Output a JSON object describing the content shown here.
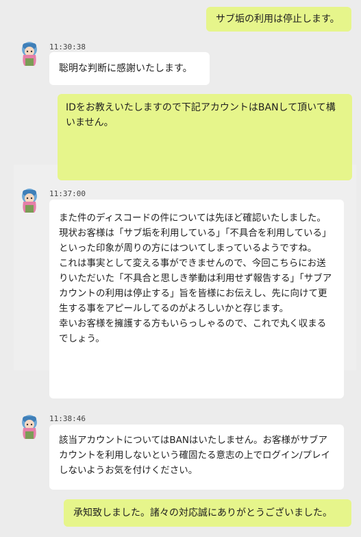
{
  "messages": [
    {
      "role": "user",
      "text": "サブ垢の利用は停止します。"
    },
    {
      "role": "agent",
      "time": "11:30:38",
      "text": "聡明な判断に感謝いたします。"
    },
    {
      "role": "user",
      "text": "IDをお教えいたしますので下記アカウントはBANして頂いて構いません。"
    },
    {
      "role": "agent",
      "time": "11:37:00",
      "text": "また件のディスコードの件については先ほど確認いたしました。\n現状お客様は「サブ垢を利用している」「不具合を利用している」といった印象が周りの方にはついてしまっているようですね。\nこれは事実として変える事ができませんので、今回こちらにお送りいただいた「不具合と思しき挙動は利用せず報告する」「サブアカウントの利用は停止する」旨を皆様にお伝えし、先に向けて更生する事をアピールしてるのがよろしいかと存じます。\n幸いお客様を擁護する方もいらっしゃるので、これで丸く収まるでしょう。"
    },
    {
      "role": "agent",
      "time": "11:38:46",
      "text": "該当アカウントについてはBANはいたしません。お客様がサブアカウントを利用しないという確固たる意志の上でログイン/プレイしないようお気を付けください。"
    },
    {
      "role": "user",
      "text": "承知致しました。諸々の対応誠にありがとうございました。"
    }
  ],
  "colors": {
    "user_bubble": "#e6f58b",
    "agent_bubble": "#ffffff",
    "background": "#ececec"
  },
  "icons": {
    "agent_avatar": "anime-avatar-icon"
  }
}
